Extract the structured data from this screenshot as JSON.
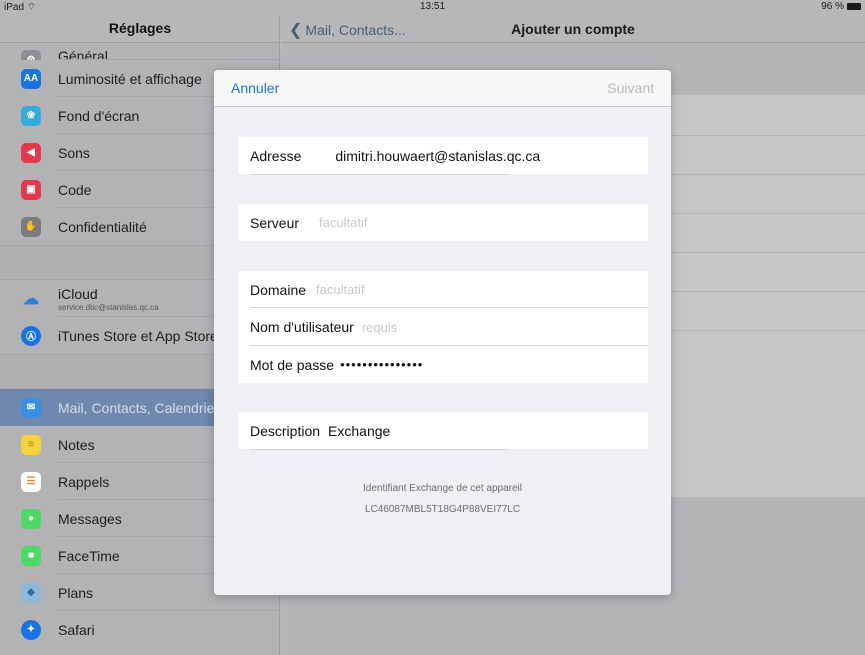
{
  "status_bar": {
    "device": "iPad",
    "time": "13:51",
    "battery": "96 %"
  },
  "sidebar": {
    "title": "Réglages",
    "items": [
      {
        "label": "Général",
        "icon": "gear-icon",
        "color": "#8e8e93"
      },
      {
        "label": "Luminosité et affichage",
        "icon": "aa-icon",
        "color": "#1a74e0",
        "glyph": "AA"
      },
      {
        "label": "Fond d'écran",
        "icon": "flower-icon",
        "color": "#36aadc",
        "glyph": "❀"
      },
      {
        "label": "Sons",
        "icon": "speaker-icon",
        "color": "#e03a4c",
        "glyph": "◀)"
      },
      {
        "label": "Code",
        "icon": "lock-icon",
        "color": "#e03a4c",
        "glyph": "🔒"
      },
      {
        "label": "Confidentialité",
        "icon": "hand-icon",
        "color": "#7a7a80",
        "glyph": "✋"
      }
    ],
    "items2": [
      {
        "label": "iCloud",
        "sub": "service.dtic@stanislas.qc.ca",
        "icon": "cloud-icon",
        "color": "#5aa0e0"
      },
      {
        "label": "iTunes Store et App Store",
        "icon": "appstore-icon",
        "color": "#1a74e0",
        "glyph": "Ⓐ"
      }
    ],
    "items3": [
      {
        "label": "Mail, Contacts, Calendrier",
        "icon": "mail-icon",
        "color": "#1a74e0",
        "glyph": "✉",
        "selected": true
      },
      {
        "label": "Notes",
        "icon": "notes-icon",
        "color": "#f5d33a",
        "glyph": "≡"
      },
      {
        "label": "Rappels",
        "icon": "reminders-icon",
        "color": "#ffffff",
        "glyph": "☰"
      },
      {
        "label": "Messages",
        "icon": "messages-icon",
        "color": "#4cd964",
        "glyph": "●"
      },
      {
        "label": "FaceTime",
        "icon": "facetime-icon",
        "color": "#4cd964",
        "glyph": "■"
      },
      {
        "label": "Plans",
        "icon": "maps-icon",
        "color": "#8fb8d8",
        "glyph": "◆"
      },
      {
        "label": "Safari",
        "icon": "safari-icon",
        "color": "#1a74e0",
        "glyph": "✦"
      }
    ]
  },
  "detail": {
    "back_label": "Mail, Contacts...",
    "title": "Ajouter un compte"
  },
  "modal": {
    "cancel_label": "Annuler",
    "next_label": "Suivant",
    "address": {
      "label": "Adresse",
      "value": "dimitri.houwaert@stanislas.qc.ca"
    },
    "server": {
      "label": "Serveur",
      "placeholder": "facultatif"
    },
    "domain": {
      "label": "Domaine",
      "placeholder": "facultatif"
    },
    "username": {
      "label": "Nom d'utilisateur",
      "placeholder": "requis"
    },
    "password": {
      "label": "Mot de passe",
      "value": "•••••••••••••••"
    },
    "description": {
      "label": "Description",
      "value": "Exchange"
    },
    "footer_title": "Identifiant Exchange de cet appareil",
    "footer_id": "LC46087MBL5T18G4P88VEI77LC"
  }
}
